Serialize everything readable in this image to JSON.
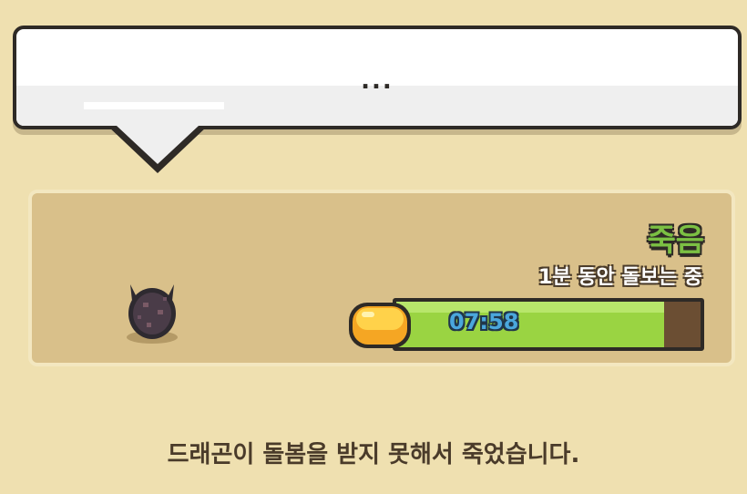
{
  "colors": {
    "background": "#efe0b0",
    "status_text": "#7bc043",
    "progress_fill": "#9ad442",
    "progress_empty": "#6b4e33",
    "timer_text": "#4aa7dc"
  },
  "speech_bubble": {
    "text": "..."
  },
  "dragon_card": {
    "dragon_icon": "dark-horned-dragon-egg-icon",
    "status": "죽음",
    "care_label": "1분 동안 돌보는 중",
    "timer": {
      "icon": "gold-egg-icon",
      "time": "07:58",
      "progress": 0.88
    }
  },
  "message": "드래곤이 돌봄을 받지 못해서 죽었습니다."
}
